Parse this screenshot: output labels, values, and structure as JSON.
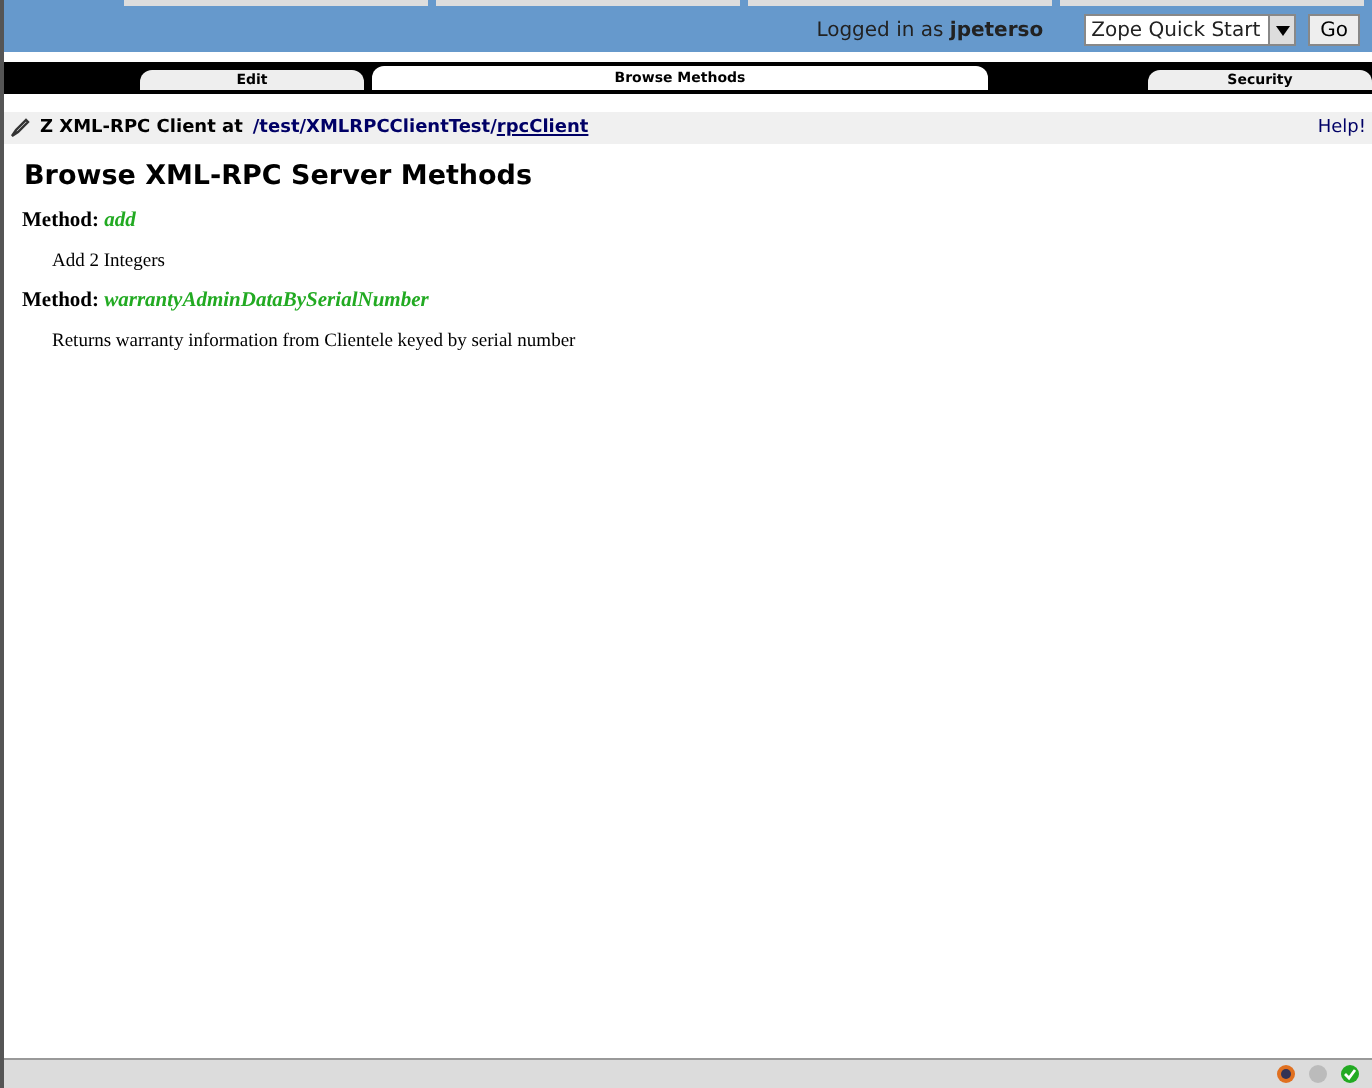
{
  "header": {
    "logged_in_label": "Logged in as",
    "user": "jpeterso",
    "quick_start": {
      "value": "Zope Quick Start"
    },
    "go_button": "Go"
  },
  "tabs": [
    {
      "label": "Edit",
      "selected": false
    },
    {
      "label": "Browse Methods",
      "selected": true
    },
    {
      "label": "Security",
      "selected": false
    }
  ],
  "breadcrumb": {
    "prefix": "Z XML-RPC Client at",
    "path": [
      {
        "label": "/test",
        "link": false
      },
      {
        "label": "/XMLRPCClientTest",
        "link": false
      },
      {
        "label": "/",
        "link": false
      },
      {
        "label": "rpcClient",
        "link": true
      }
    ],
    "help": "Help!"
  },
  "title": "Browse XML-RPC Server Methods",
  "methods": [
    {
      "label": "Method:",
      "name": "add",
      "description": "Add 2 Integers"
    },
    {
      "label": "Method:",
      "name": "warrantyAdminDataBySerialNumber",
      "description": "Returns warranty information from Clientele keyed by serial number"
    }
  ]
}
